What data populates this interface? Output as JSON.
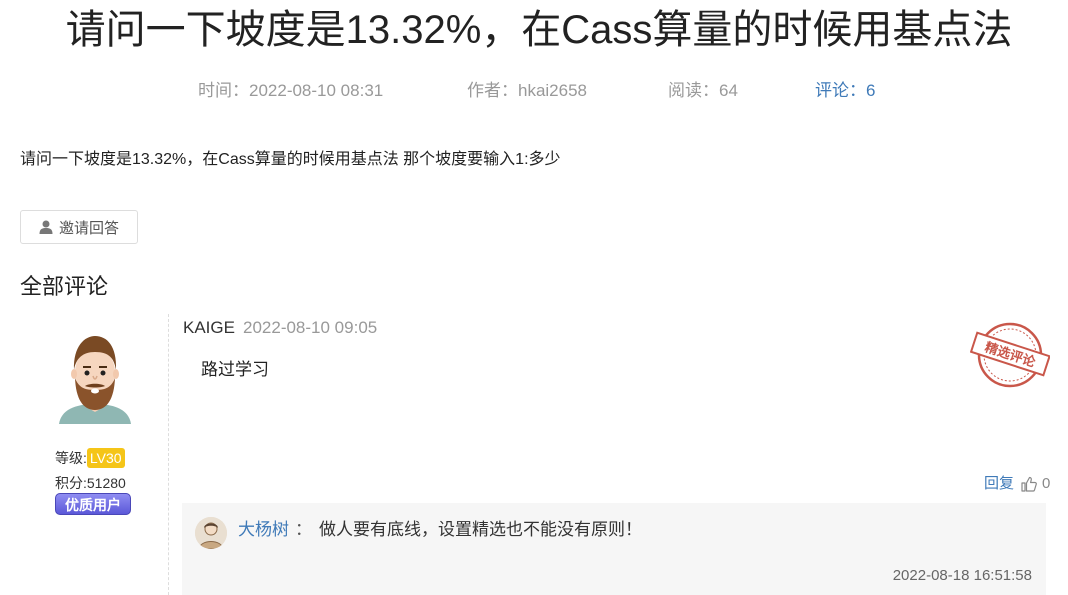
{
  "article": {
    "title": "请问一下坡度是13.32%，在Cass算量的时候用基点法",
    "time_label": "时间：",
    "time_value": "2022-08-10 08:31",
    "author_label": "作者：",
    "author_value": "hkai2658",
    "views_label": "阅读：",
    "views_value": "64",
    "comments_label": "评论：",
    "comments_value": "6",
    "question": "请问一下坡度是13.32%，在Cass算量的时候用基点法 那个坡度要输入1:多少",
    "invite_label": "邀请回答",
    "invite_icon": "user-icon"
  },
  "comments_section": {
    "title": "全部评论"
  },
  "comment": {
    "author": "KAIGE",
    "time": "2022-08-10 09:05",
    "body": "路过学习",
    "level_label": "等级:",
    "level_value": "LV30",
    "score": "积分:51280",
    "quality_badge": "优质用户",
    "stamp_text": "精选评论",
    "reply_label": "回复",
    "like_count": "0",
    "like_icon": "thumbs-up-icon",
    "colors": {
      "link": "#3f7ab8",
      "level_badge": "#f5c518",
      "stamp": "#c9574a"
    }
  },
  "reply": {
    "user": "大杨树",
    "colon": "：",
    "text": "做人要有底线，设置精选也不能没有原则！",
    "time": "2022-08-18 16:51:58"
  }
}
